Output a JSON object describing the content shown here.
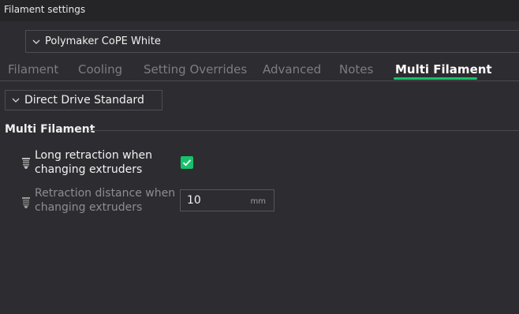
{
  "window": {
    "title": "Filament settings"
  },
  "preset": {
    "selected": "Polymaker CoPE White",
    "icon": "chevron-down-icon"
  },
  "tabs": [
    {
      "label": "Filament",
      "active": false
    },
    {
      "label": "Cooling",
      "active": false
    },
    {
      "label": "Setting Overrides",
      "active": false
    },
    {
      "label": "Advanced",
      "active": false
    },
    {
      "label": "Notes",
      "active": false
    },
    {
      "label": "Multi Filament",
      "active": true
    }
  ],
  "extruder": {
    "selected": "Direct Drive Standard",
    "icon": "chevron-down-icon"
  },
  "section": {
    "title": "Multi Filament"
  },
  "options": {
    "long_retraction": {
      "label": "Long retraction when changing extruders",
      "checked": true,
      "icon": "nozzle-icon"
    },
    "retraction_distance": {
      "label": "Retraction distance when changing extruders",
      "value": "10",
      "unit": "mm",
      "icon": "nozzle-icon"
    }
  },
  "colors": {
    "accent": "#15c36a",
    "background": "#2d2d31",
    "titlebar": "#252528"
  }
}
